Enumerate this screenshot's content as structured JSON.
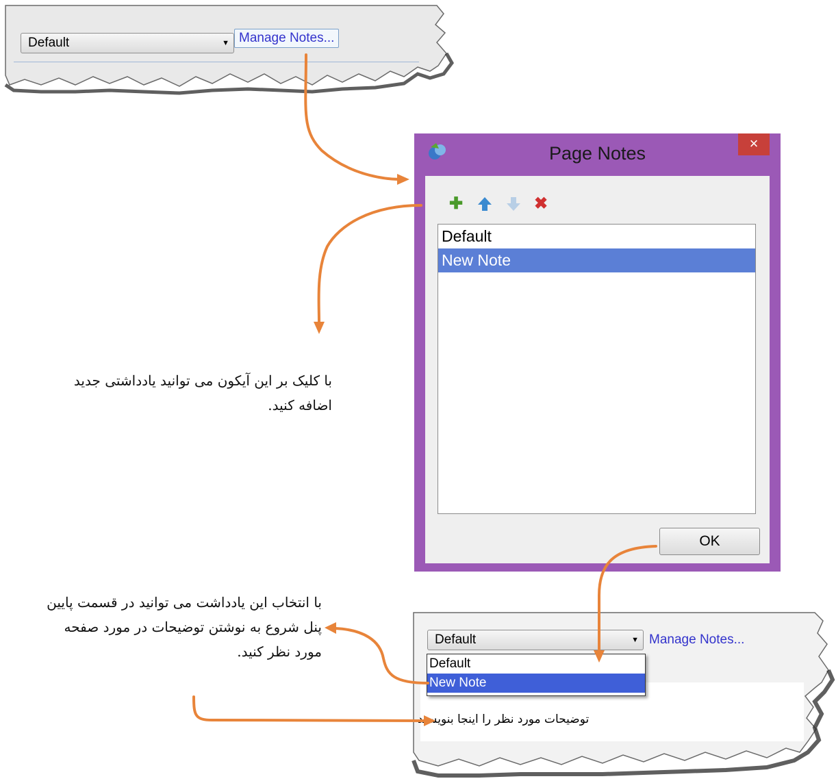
{
  "top_snippet": {
    "combo_value": "Default",
    "manage_link": "Manage Notes..."
  },
  "dialog": {
    "title": "Page Notes",
    "close_glyph": "×",
    "toolbar": {
      "add_icon": "plus-icon",
      "up_icon": "arrow-up-icon",
      "down_icon": "arrow-down-icon",
      "delete_icon": "delete-icon"
    },
    "notes": [
      "Default",
      "New Note"
    ],
    "selected_note": "New Note",
    "ok_label": "OK"
  },
  "bottom_snippet": {
    "combo_value": "Default",
    "manage_link": "Manage Notes...",
    "dropdown_options": [
      "Default",
      "New Note"
    ],
    "selected_option": "New Note",
    "notes_text": "توضیحات مورد نظر را اینجا بنویسید"
  },
  "annotations": {
    "add_note_caption": [
      "با کلیک بر این آیکون می توانید یادداشتی جدید",
      "اضافه کنید."
    ],
    "select_note_caption": [
      "با انتخاب این یادداشت می توانید در قسمت پایین",
      "پنل شروع به نوشتن توضیحات در مورد صفحه",
      "مورد نظر کنید."
    ]
  },
  "colors": {
    "dialog_frame": "#9b59b6",
    "close_button": "#c7403a",
    "selection": "#5b7fd6",
    "arrow": "#e8843a",
    "link": "#3333cc"
  }
}
